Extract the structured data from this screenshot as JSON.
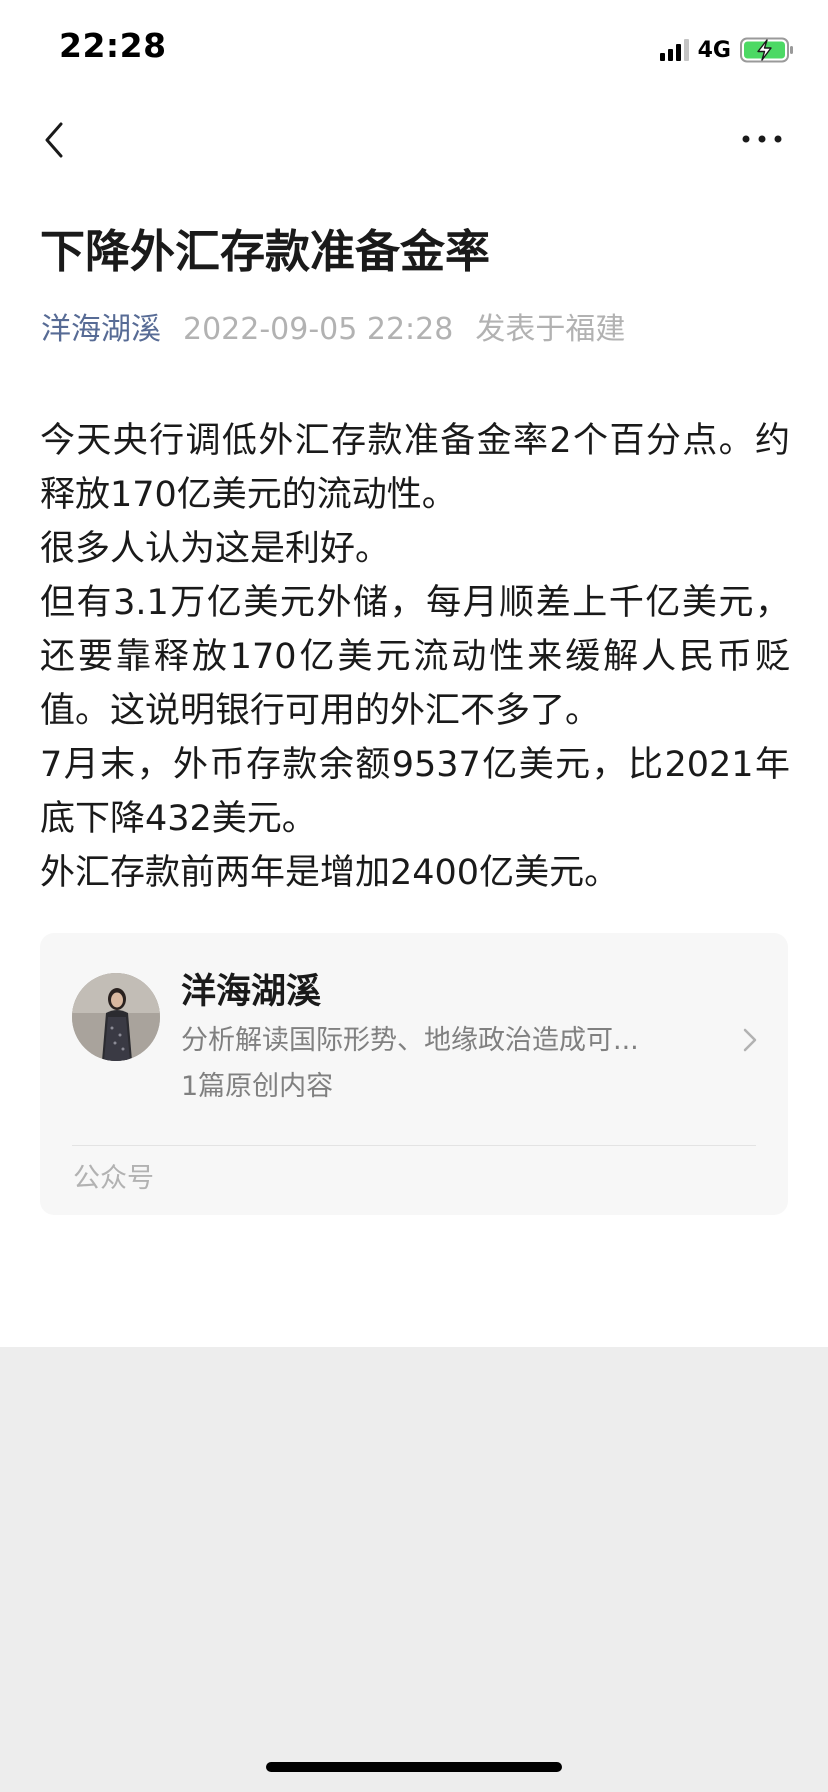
{
  "status_bar": {
    "time": "22:28",
    "network": "4G"
  },
  "nav": {
    "back_icon": "chevron-left-icon",
    "more_icon": "more-dots-icon"
  },
  "article": {
    "title": "下降外汇存款准备金率",
    "author": "洋海湖溪",
    "date": "2022-09-05 22:28",
    "location": "发表于福建",
    "paragraphs": [
      "今天央行调低外汇存款准备金率2个百分点。约释放170亿美元的流动性。",
      "很多人认为这是利好。",
      "但有3.1万亿美元外储，每月顺差上千亿美元，还要靠释放170亿美元流动性来缓解人民币贬值。这说明银行可用的外汇不多了。",
      "7月末，外币存款余额9537亿美元，比2021年底下降432美元。",
      "外汇存款前两年是增加2400亿美元。"
    ]
  },
  "profile_card": {
    "name": "洋海湖溪",
    "description": "分析解读国际形势、地缘政治造成可...",
    "count": "1篇原创内容",
    "footer": "公众号"
  },
  "colors": {
    "link": "#576b95",
    "meta_gray": "#b2b2b2",
    "card_bg": "#f7f7f7",
    "battery_green": "#4cd964"
  }
}
